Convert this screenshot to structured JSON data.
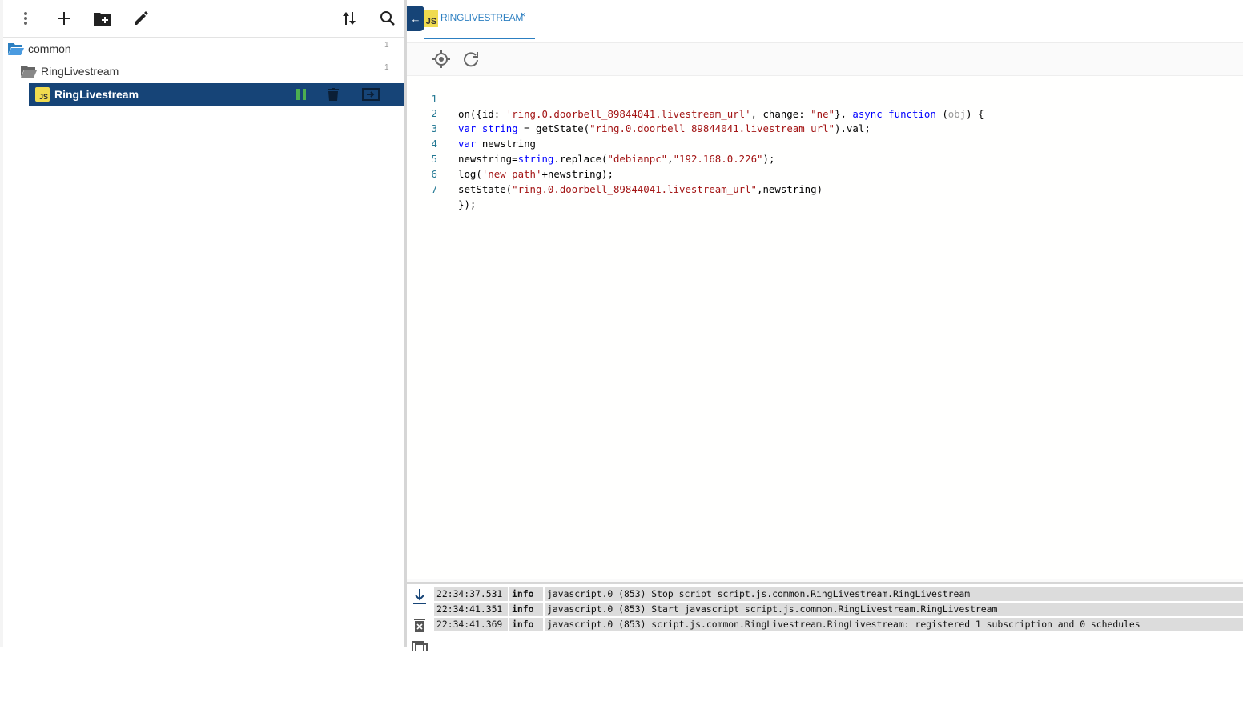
{
  "toolbar": {
    "menu_icon": "more-vert-icon",
    "add_icon": "add-icon",
    "add_folder_icon": "create-new-folder-icon",
    "edit_icon": "edit-icon",
    "sort_icon": "sort-icon",
    "search_icon": "search-icon"
  },
  "tree": {
    "items": [
      {
        "label": "common",
        "count": "1",
        "type": "folder-open"
      },
      {
        "label": "RingLivestream",
        "count": "1",
        "type": "folder-open"
      },
      {
        "label": "RingLivestream",
        "type": "script",
        "badge": "JS",
        "selected": true
      }
    ]
  },
  "editor_tab": {
    "badge": "JS",
    "label": "RINGLIVESTREAM",
    "close": "×",
    "back": "←"
  },
  "code": {
    "line_numbers": [
      "1",
      "2",
      "3",
      "4",
      "5",
      "6",
      "7"
    ]
  },
  "log": {
    "rows": [
      {
        "time": "22:34:37.531",
        "level": "info",
        "message": "javascript.0 (853) Stop script script.js.common.RingLivestream.RingLivestream"
      },
      {
        "time": "22:34:41.351",
        "level": "info",
        "message": "javascript.0 (853) Start javascript script.js.common.RingLivestream.RingLivestream"
      },
      {
        "time": "22:34:41.369",
        "level": "info",
        "message": "javascript.0 (853) script.js.common.RingLivestream.RingLivestream: registered 1 subscription and 0 schedules"
      }
    ]
  },
  "colors": {
    "selected_row": "#164477",
    "accent": "#2c7fc1",
    "running": "#4caf50",
    "js_badge": "#f0db4f"
  }
}
